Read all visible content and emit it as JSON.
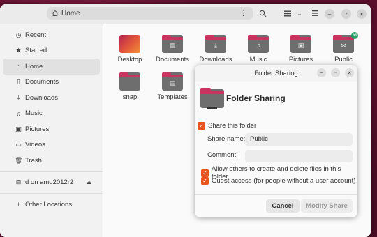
{
  "header": {
    "path_label": "Home",
    "icons": [
      "home-icon",
      "kebab-icon",
      "search-icon",
      "list-view-icon",
      "view-options-icon",
      "menu-icon",
      "minimize-icon",
      "maximize-icon",
      "close-icon"
    ]
  },
  "sidebar": {
    "items": [
      {
        "label": "Recent",
        "icon": "clock-icon"
      },
      {
        "label": "Starred",
        "icon": "star-icon"
      },
      {
        "label": "Home",
        "icon": "home-icon"
      },
      {
        "label": "Documents",
        "icon": "document-icon"
      },
      {
        "label": "Downloads",
        "icon": "download-icon"
      },
      {
        "label": "Music",
        "icon": "music-icon"
      },
      {
        "label": "Pictures",
        "icon": "picture-icon"
      },
      {
        "label": "Videos",
        "icon": "video-icon"
      },
      {
        "label": "Trash",
        "icon": "trash-icon"
      }
    ],
    "network": {
      "label": "d on amd2012r2",
      "icon": "network-drive-icon"
    },
    "other_locations": "Other Locations"
  },
  "folders": [
    {
      "label": "Desktop"
    },
    {
      "label": "Documents"
    },
    {
      "label": "Downloads"
    },
    {
      "label": "Music"
    },
    {
      "label": "Pictures"
    },
    {
      "label": "Public"
    },
    {
      "label": "snap"
    },
    {
      "label": "Templates"
    }
  ],
  "dialog": {
    "window_title": "Folder Sharing",
    "heading": "Folder Sharing",
    "share_this_folder": "Share this folder",
    "share_name_label": "Share name:",
    "share_name_value": "Public",
    "comment_label": "Comment:",
    "comment_value": "",
    "allow_others": "Allow others to create and delete files in this folder",
    "guest_access": "Guest access (for people without a user account)",
    "cancel": "Cancel",
    "modify": "Modify Share"
  },
  "colors": {
    "accent": "#e95420",
    "folder_tab": "#c7345f",
    "folder_body": "#6e6e6e",
    "share_badge": "#26a269"
  }
}
